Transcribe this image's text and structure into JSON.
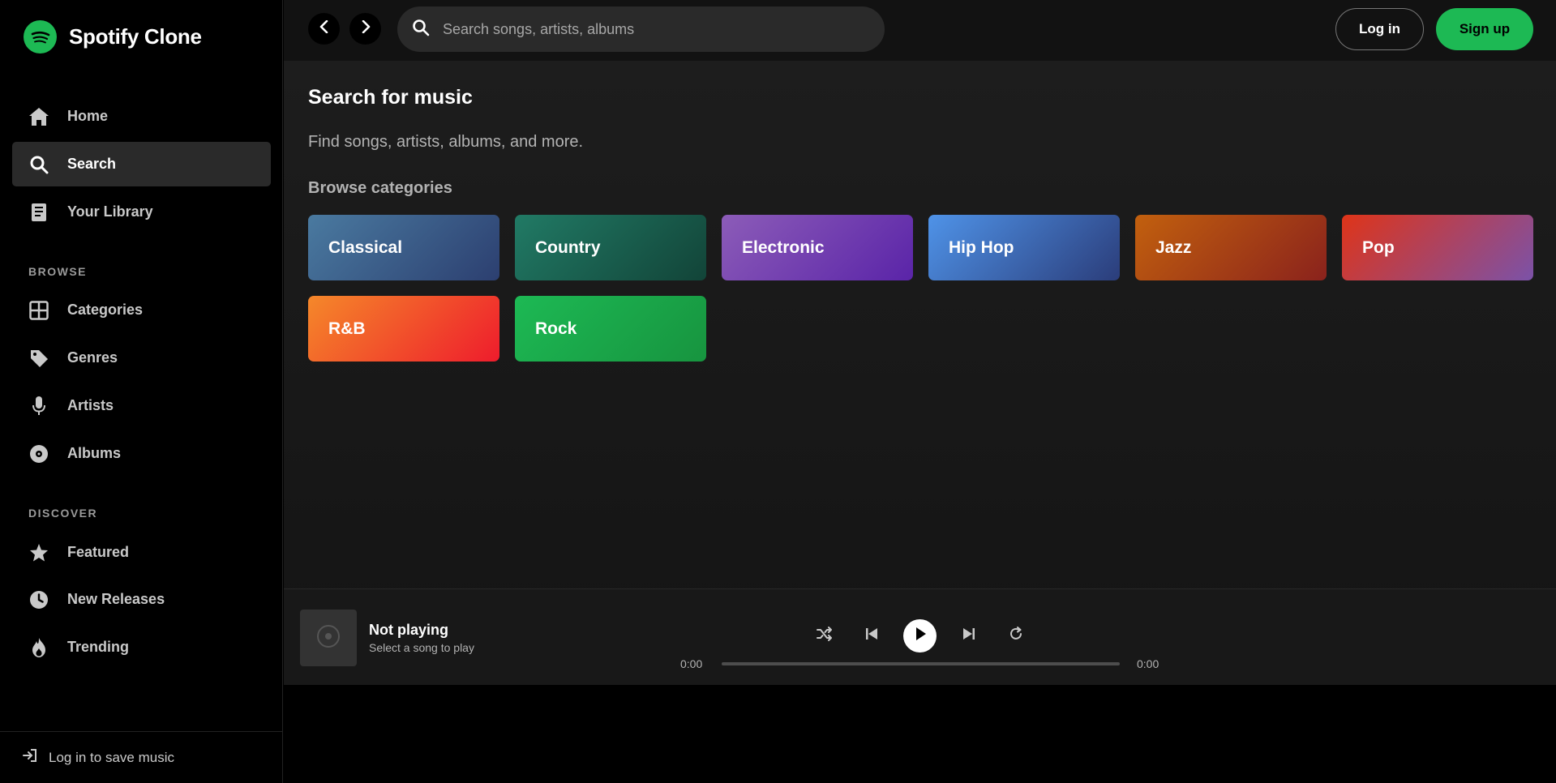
{
  "brand": {
    "name": "Spotify Clone",
    "accent": "#1db954"
  },
  "sidebar": {
    "main_items": [
      {
        "label": "Home",
        "icon": "home-icon"
      },
      {
        "label": "Search",
        "icon": "search-icon",
        "active": true
      },
      {
        "label": "Your Library",
        "icon": "library-icon"
      }
    ],
    "browse_heading": "BROWSE",
    "browse_items": [
      {
        "label": "Categories",
        "icon": "grid-icon"
      },
      {
        "label": "Genres",
        "icon": "tag-icon"
      },
      {
        "label": "Artists",
        "icon": "microphone-icon"
      },
      {
        "label": "Albums",
        "icon": "disc-icon"
      }
    ],
    "discover_heading": "DISCOVER",
    "discover_items": [
      {
        "label": "Featured",
        "icon": "star-icon"
      },
      {
        "label": "New Releases",
        "icon": "clock-icon"
      },
      {
        "label": "Trending",
        "icon": "fire-icon"
      }
    ],
    "footer_label": "Log in to save music"
  },
  "topbar": {
    "search_placeholder": "Search songs, artists, albums",
    "login_label": "Log in",
    "signup_label": "Sign up"
  },
  "main": {
    "title": "Search for music",
    "subtitle": "Find songs, artists, albums, and more.",
    "section_title": "Browse categories",
    "categories": [
      {
        "label": "Classical",
        "colors": [
          "#4a7aa0",
          "#2c3f70"
        ]
      },
      {
        "label": "Country",
        "colors": [
          "#217a65",
          "#124438"
        ]
      },
      {
        "label": "Electronic",
        "colors": [
          "#8c5cb8",
          "#5a24a8"
        ]
      },
      {
        "label": "Hip Hop",
        "colors": [
          "#4f93e8",
          "#2b3d7a"
        ]
      },
      {
        "label": "Jazz",
        "colors": [
          "#c2600e",
          "#8a221c"
        ]
      },
      {
        "label": "Pop",
        "colors": [
          "#df3418",
          "#7b52a8"
        ]
      },
      {
        "label": "R&B",
        "colors": [
          "#f5882a",
          "#ee1c2c"
        ]
      },
      {
        "label": "Rock",
        "colors": [
          "#1db954",
          "#17943f"
        ]
      }
    ]
  },
  "player": {
    "title": "Not playing",
    "subtitle": "Select a song to play",
    "time_current": "0:00",
    "time_total": "0:00",
    "progress": 0
  }
}
